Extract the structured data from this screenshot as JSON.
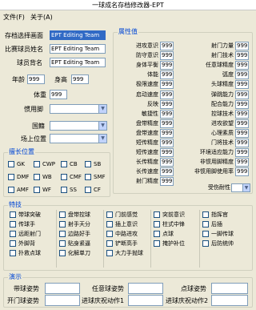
{
  "window": {
    "title": "一球成名存档修改器-EPT"
  },
  "menu": {
    "file": "文件(F)",
    "about": "关于(A)"
  },
  "player": {
    "save_label": "存档选择画面",
    "save_value": "EPT Editing Team",
    "match_name_label": "比赛球员姓名",
    "match_name_value": "EPT Editing Team",
    "back_name_label": "球员背名",
    "back_name_value": "EPT Editing Team",
    "age_label": "年龄",
    "age_value": "999",
    "height_label": "身高",
    "height_value": "999",
    "weight_label": "体重",
    "weight_value": "999",
    "foot_label": "惯用脚",
    "nation_label": "国籍",
    "position_label": "场上位置"
  },
  "positions": {
    "title": "擅长位置",
    "items": [
      "GK",
      "CWP",
      "CB",
      "SB",
      "DMF",
      "WB",
      "CMF",
      "SMF",
      "AMF",
      "WF",
      "SS",
      "CF"
    ]
  },
  "attributes": {
    "title": "属性值",
    "left": [
      {
        "label": "进攻意识",
        "value": "999"
      },
      {
        "label": "防守意识",
        "value": "999"
      },
      {
        "label": "身体平衡",
        "value": "999"
      },
      {
        "label": "体能",
        "value": "999"
      },
      {
        "label": "极限速度",
        "value": "999"
      },
      {
        "label": "启动速度",
        "value": "999"
      },
      {
        "label": "反映",
        "value": "999"
      },
      {
        "label": "敏捷性",
        "value": "999"
      },
      {
        "label": "盘带精度",
        "value": "999"
      },
      {
        "label": "盘带速度",
        "value": "999"
      },
      {
        "label": "短传精度",
        "value": "999"
      },
      {
        "label": "短传速度",
        "value": "999"
      },
      {
        "label": "长传精度",
        "value": "999"
      },
      {
        "label": "长传速度",
        "value": "999"
      },
      {
        "label": "射门精度",
        "value": "999"
      }
    ],
    "right": [
      {
        "label": "射门力量",
        "value": "999"
      },
      {
        "label": "射门技术",
        "value": "999"
      },
      {
        "label": "任意球精度",
        "value": "999"
      },
      {
        "label": "弧度",
        "value": "999"
      },
      {
        "label": "头球精度",
        "value": "999"
      },
      {
        "label": "弹跳能力",
        "value": "999"
      },
      {
        "label": "配合能力",
        "value": "999"
      },
      {
        "label": "控球技术",
        "value": "999"
      },
      {
        "label": "进攻欲望",
        "value": "999"
      },
      {
        "label": "心理素质",
        "value": "999"
      },
      {
        "label": "门将技术",
        "value": "999"
      },
      {
        "label": "环境适应能力",
        "value": "999"
      },
      {
        "label": "非惯用脚精度",
        "value": "999"
      },
      {
        "label": "非惯用脚使用率",
        "value": "999"
      }
    ],
    "injury_label": "受伤耐性"
  },
  "specials": {
    "title": "特技",
    "items": [
      "带球突破",
      "盘带控球",
      "门前感觉",
      "突前意识",
      "指挥官",
      "传球手",
      "射手天分",
      "插上意识",
      "柱式中锋",
      "后插",
      "远距射门",
      "边路好手",
      "中路进攻",
      "点球",
      "一脚传球",
      "外脚背",
      "贴身紧逼",
      "铲断高手",
      "掩护补位",
      "后防统帅",
      "扑救点球",
      "化解单刀",
      "大力手抛球"
    ]
  },
  "demo": {
    "title": "演示",
    "dribble_label": "带球姿势",
    "freekick_label": "任意球姿势",
    "penalty_label": "点球姿势",
    "kickoff_label": "开门球姿势",
    "celebrate1_label": "进球庆祝动作1",
    "celebrate2_label": "进球庆祝动作2"
  }
}
